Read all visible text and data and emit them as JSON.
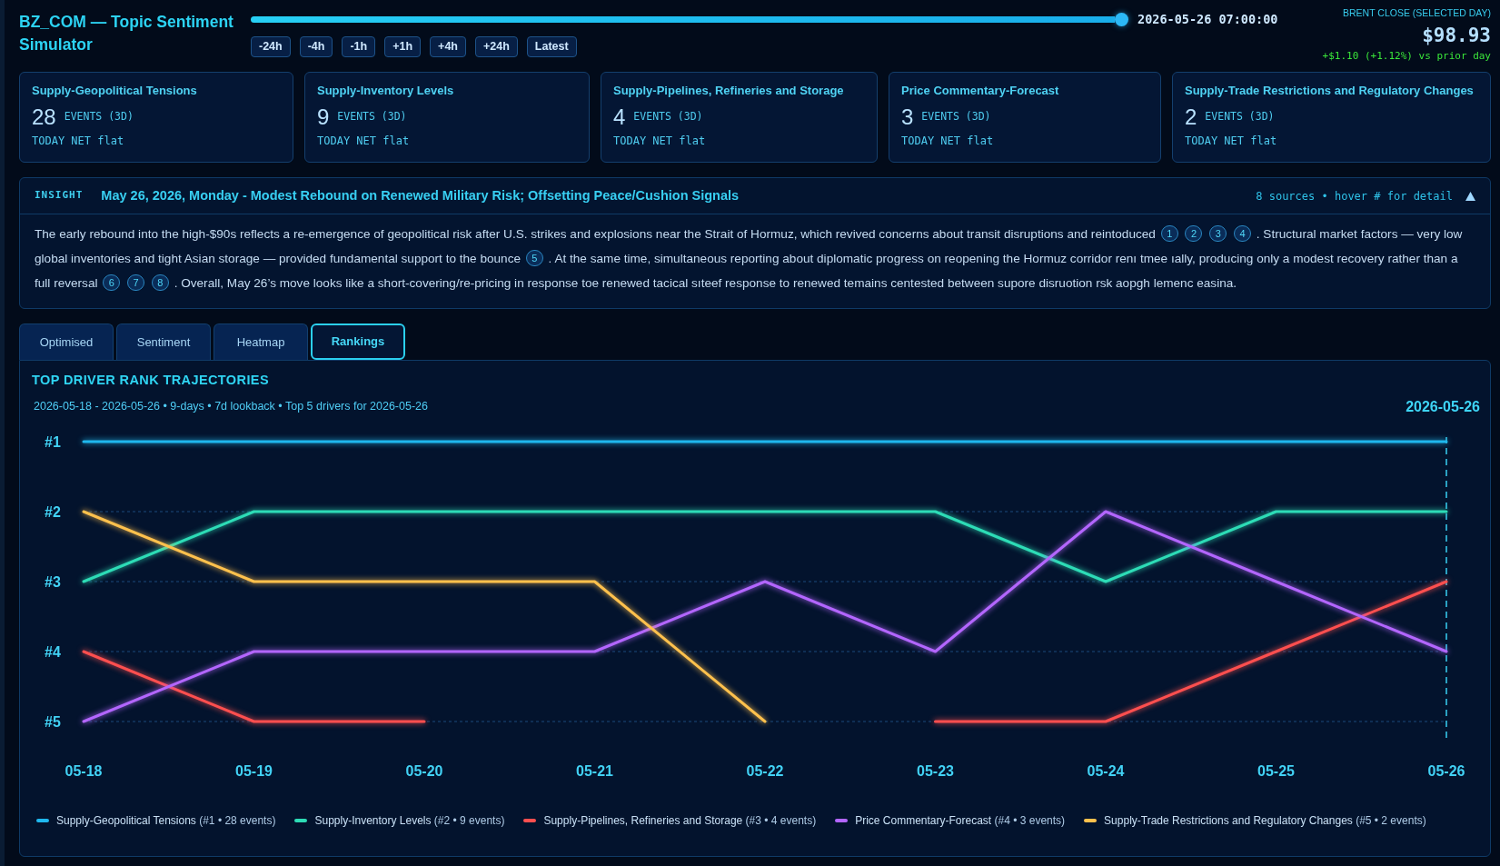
{
  "header": {
    "title": "BZ_COM — Topic Sentiment Simulator",
    "timeline": {
      "level": 1.0,
      "timestamp": "2026-05-26 07:00:00"
    },
    "step_buttons": [
      "-24h",
      "-4h",
      "-1h",
      "+1h",
      "+4h",
      "+24h",
      "Latest"
    ],
    "price": {
      "label": "BRENT CLOSE (SELECTED DAY)",
      "value": "$98.93",
      "change": "+$1.10 (+1.12%) vs prior day"
    }
  },
  "driver_cards": [
    {
      "title": "Supply-Geopolitical Tensions",
      "count": "28",
      "unit": "EVENTS (3D)",
      "net": "TODAY NET flat"
    },
    {
      "title": "Supply-Inventory Levels",
      "count": "9",
      "unit": "EVENTS (3D)",
      "net": "TODAY NET flat"
    },
    {
      "title": "Supply-Pipelines, Refineries and Storage",
      "count": "4",
      "unit": "EVENTS (3D)",
      "net": "TODAY NET flat"
    },
    {
      "title": "Price Commentary-Forecast",
      "count": "3",
      "unit": "EVENTS (3D)",
      "net": "TODAY NET flat"
    },
    {
      "title": "Supply-Trade Restrictions and Regulatory Changes",
      "count": "2",
      "unit": "EVENTS (3D)",
      "net": "TODAY NET flat"
    }
  ],
  "insight": {
    "label": "INSIGHT",
    "title": "May 26, 2026, Monday - Modest Rebound on Renewed Military Risk; Offsetting Peace/Cushion Signals",
    "meta": "8 sources • hover # for detail",
    "expanded": true,
    "body": [
      {
        "kind": "text",
        "text": "The early rebound into the high-$90s reflects a re-emergence of geopolitical risk after U.S. strikes and explosions near the Strait of Hormuz, which revived concerns about transit disruptions and reintoduced"
      },
      {
        "kind": "cite",
        "text": "1"
      },
      {
        "kind": "cite",
        "text": "2"
      },
      {
        "kind": "cite",
        "text": "3"
      },
      {
        "kind": "cite",
        "text": "4"
      },
      {
        "kind": "text",
        "text": ". Structural market factors — very low global inventories and tight Asian storage — provided fundamental support to the bounce"
      },
      {
        "kind": "cite",
        "text": "5"
      },
      {
        "kind": "text",
        "text": ". At the same time, simultaneous reporting about diplomatic progress on reopening the Hormuz corridor renı tmee ıally, producing only a modest recovery rather than a full reversal"
      },
      {
        "kind": "cite",
        "text": "6"
      },
      {
        "kind": "cite",
        "text": "7"
      },
      {
        "kind": "cite",
        "text": "8"
      },
      {
        "kind": "text",
        "text": ". Overall, May 26’s move looks like a short-covering/re-pricing in response toe renewed tacical sıteef response to renewed temains centested between supore disruotion rsk aopgh lemenc easina."
      }
    ]
  },
  "tabs": [
    {
      "label": "Optimised",
      "selected": false
    },
    {
      "label": "Sentiment",
      "selected": false
    },
    {
      "label": "Heatmap",
      "selected": false
    },
    {
      "label": "Rankings",
      "selected": true
    }
  ],
  "rankings_panel": {
    "title": "TOP DRIVER RANK TRAJECTORIES",
    "subtitle": "2026-05-18 - 2026-05-26 • 9-days • 7d lookback • Top 5 drivers for 2026-05-26",
    "chart_data": {
      "type": "line",
      "categories": [
        "05-18",
        "05-19",
        "05-20",
        "05-21",
        "05-22",
        "05-23",
        "05-24",
        "05-25",
        "05-26"
      ],
      "series": [
        {
          "name": "Supply-Geopolitical Tensions",
          "color": "#1fb8ee",
          "values": [
            1,
            1,
            1,
            1,
            1,
            1,
            1,
            1,
            1
          ]
        },
        {
          "name": "Supply-Inventory Levels",
          "color": "#2ddcb6",
          "values": [
            3,
            2,
            2,
            2,
            2,
            2,
            3,
            2,
            2
          ]
        },
        {
          "name": "Supply-Pipelines, Refineries and Storage",
          "color": "#ff4f4f",
          "values": [
            4,
            5,
            5,
            null,
            null,
            5,
            5,
            4,
            3
          ]
        },
        {
          "name": "Price Commentary-Forecast",
          "color": "#b366ff",
          "values": [
            5,
            4,
            4,
            4,
            3,
            4,
            2,
            3,
            4
          ]
        },
        {
          "name": "Supply-Trade Restrictions and Regulatory Changes",
          "color": "#ffc14d",
          "values": [
            2,
            3,
            3,
            3,
            5,
            null,
            null,
            null,
            null
          ]
        }
      ],
      "ylim": [
        5,
        1
      ],
      "yticks": [
        {
          "value": 1,
          "label": "#1"
        },
        {
          "value": 2,
          "label": "#2"
        },
        {
          "value": 3,
          "label": "#3"
        },
        {
          "value": 4,
          "label": "#4"
        },
        {
          "value": 5,
          "label": "#5"
        }
      ],
      "grid": true,
      "annotations": [
        "2026-05-26"
      ]
    },
    "legend_details": [
      "(#1 • 28 events)",
      "(#2 • 9 events)",
      "(#3 • 4 events)",
      "(#4 • 3 events)",
      "(#5 • 2 events)"
    ]
  }
}
